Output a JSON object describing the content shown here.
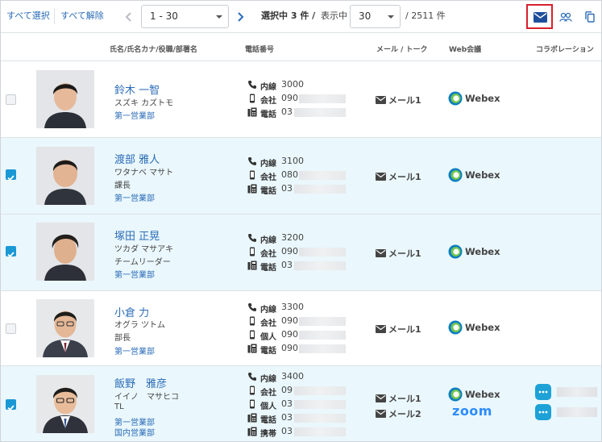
{
  "toolbar": {
    "select_all": "すべて選択",
    "deselect_all": "すべて解除",
    "page_range": "1 - 30",
    "selected_text": "選択中 3 件 /",
    "showing_label": "表示中",
    "per_page": "30",
    "total": "/ 2511 件"
  },
  "header": {
    "name": "氏名/氏名カナ/役職/部署名",
    "phone": "電話番号",
    "mail": "メール / トーク",
    "web": "Web会議",
    "collab": "コラボレーション"
  },
  "colors": {
    "accent": "#2b6cb8",
    "selected_row": "#eaf7fc",
    "checkbox": "#1a98d5",
    "highlight": "#d8202c"
  },
  "rows": [
    {
      "selected": false,
      "name": "鈴木 一智",
      "kana": "スズキ カズトモ",
      "role": "",
      "dept": "第一営業部",
      "dept2": "",
      "phones": [
        {
          "icon": "phone-icon",
          "label": "内線",
          "num": "3000"
        },
        {
          "icon": "mobile-icon",
          "label": "会社",
          "num": "090"
        },
        {
          "icon": "fax-icon",
          "label": "電話",
          "num": "03"
        }
      ],
      "mails": [
        "メール1"
      ],
      "web": [
        "Webex"
      ]
    },
    {
      "selected": true,
      "name": "渡部 雅人",
      "kana": "ワタナベ マサト",
      "role": "課長",
      "dept": "第一営業部",
      "dept2": "",
      "phones": [
        {
          "icon": "phone-icon",
          "label": "内線",
          "num": "3100"
        },
        {
          "icon": "mobile-icon",
          "label": "会社",
          "num": "080"
        },
        {
          "icon": "fax-icon",
          "label": "電話",
          "num": "03"
        }
      ],
      "mails": [
        "メール1"
      ],
      "web": [
        "Webex"
      ]
    },
    {
      "selected": true,
      "name": "塚田 正晃",
      "kana": "ツカダ マサアキ",
      "role": "チームリーダー",
      "dept": "第一営業部",
      "dept2": "",
      "phones": [
        {
          "icon": "phone-icon",
          "label": "内線",
          "num": "3200"
        },
        {
          "icon": "mobile-icon",
          "label": "会社",
          "num": "090"
        },
        {
          "icon": "fax-icon",
          "label": "電話",
          "num": "03"
        }
      ],
      "mails": [
        "メール1"
      ],
      "web": [
        "Webex"
      ]
    },
    {
      "selected": false,
      "name": "小倉 力",
      "kana": "オグラ ツトム",
      "role": "部長",
      "dept": "第一営業部",
      "dept2": "",
      "phones": [
        {
          "icon": "phone-icon",
          "label": "内線",
          "num": "3300"
        },
        {
          "icon": "mobile-icon",
          "label": "会社",
          "num": "090"
        },
        {
          "icon": "mobile-icon",
          "label": "個人",
          "num": "090"
        },
        {
          "icon": "fax-icon",
          "label": "電話",
          "num": "090"
        }
      ],
      "mails": [
        "メール1"
      ],
      "web": [
        "Webex"
      ]
    },
    {
      "selected": true,
      "name": "飯野　雅彦",
      "kana": "イイノ　マサヒコ",
      "role": "TL",
      "dept": "第一営業部",
      "dept2": "国内営業部",
      "phones": [
        {
          "icon": "phone-icon",
          "label": "内線",
          "num": "3400"
        },
        {
          "icon": "mobile-icon",
          "label": "会社",
          "num": "09"
        },
        {
          "icon": "mobile-icon",
          "label": "個人",
          "num": "03"
        },
        {
          "icon": "fax-icon",
          "label": "電話",
          "num": "03"
        },
        {
          "icon": "fax-icon",
          "label": "携帯",
          "num": "03"
        }
      ],
      "mails": [
        "メール1",
        "メール2"
      ],
      "web": [
        "Webex",
        "zoom"
      ],
      "collab_count": 2
    }
  ]
}
